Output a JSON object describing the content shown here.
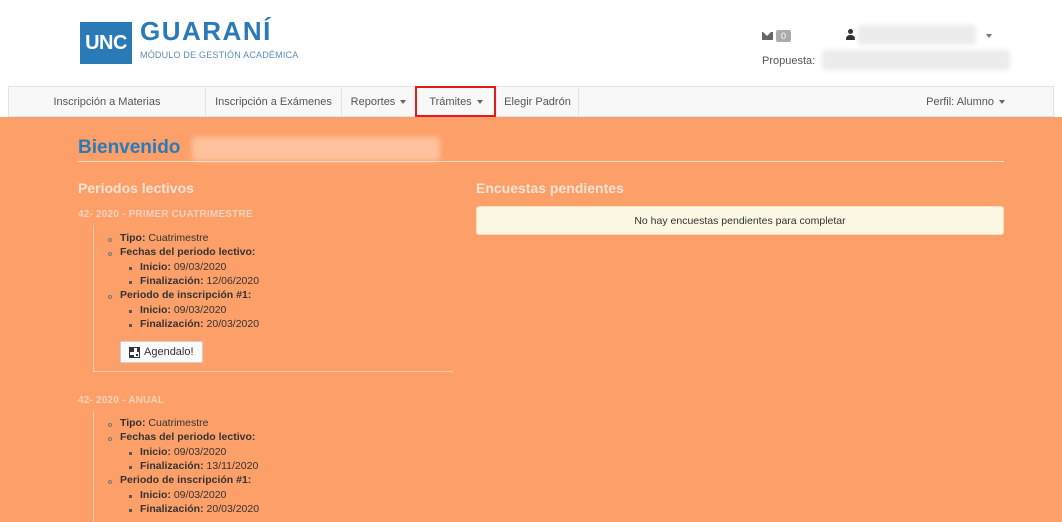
{
  "header": {
    "logo_badge": "UNC",
    "logo_title": "GUARANÍ",
    "logo_subtitle": "MÓDULO DE GESTIÓN ACADÉMICA",
    "mail_count": "0",
    "propuesta_label": "Propuesta:"
  },
  "nav": {
    "items": [
      {
        "label": "Inscripción a Materias"
      },
      {
        "label": "Inscripción a Exámenes"
      },
      {
        "label": "Reportes"
      },
      {
        "label": "Trámites"
      },
      {
        "label": "Elegir Padrón"
      }
    ],
    "perfil": "Perfil: Alumno"
  },
  "main": {
    "welcome": "Bienvenido",
    "periodos_title": "Periodos lectivos",
    "encuestas_title": "Encuestas pendientes",
    "encuestas_empty": "No hay encuestas pendientes para completar",
    "agenda_button": "Agendalo!",
    "periods": [
      {
        "title": "42- 2020 - PRIMER CUATRIMESTRE",
        "tipo_label": "Tipo:",
        "tipo_value": "Cuatrimestre",
        "fechas_label": "Fechas del periodo lectivo:",
        "inicio_label": "Inicio:",
        "inicio_value": "09/03/2020",
        "fin_label": "Finalización:",
        "fin_value": "12/06/2020",
        "insc_label": "Periodo de inscripción #1:",
        "insc_inicio_value": "09/03/2020",
        "insc_fin_value": "20/03/2020"
      },
      {
        "title": "42- 2020 - ANUAL",
        "tipo_label": "Tipo:",
        "tipo_value": "Cuatrimestre",
        "fechas_label": "Fechas del periodo lectivo:",
        "inicio_label": "Inicio:",
        "inicio_value": "09/03/2020",
        "fin_label": "Finalización:",
        "fin_value": "13/11/2020",
        "insc_label": "Periodo de inscripción #1:",
        "insc_inicio_value": "09/03/2020",
        "insc_fin_value": "20/03/2020"
      }
    ]
  },
  "colors": {
    "brand": "#2a7ab8",
    "main_background": "#fd9f68",
    "highlight": "#e21b1b"
  }
}
